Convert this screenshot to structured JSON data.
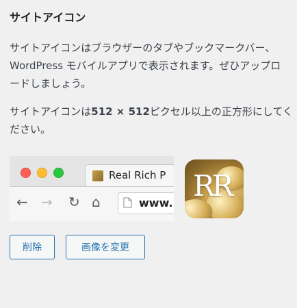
{
  "section": {
    "title": "サイトアイコン",
    "description": "サイトアイコンはブラウザーのタブやブックマークバー、WordPress モバイルアプリで表示されます。ぜひアップロードしましょう。",
    "size_note_prefix": "サイトアイコンは",
    "size_note_bold": "512 × 512",
    "size_note_suffix": "ピクセル以上の正方形にしてください。"
  },
  "preview": {
    "tab_title": "Real Rich P",
    "address_text": "www.",
    "nav_back": "←",
    "nav_forward": "→",
    "nav_reload": "↻",
    "nav_home": "⌂"
  },
  "site_icon": {
    "monogram": "RR"
  },
  "buttons": {
    "remove_label": "削除",
    "change_label": "画像を変更"
  },
  "colors": {
    "accent": "#2271b1",
    "background": "#f0f0f1"
  }
}
